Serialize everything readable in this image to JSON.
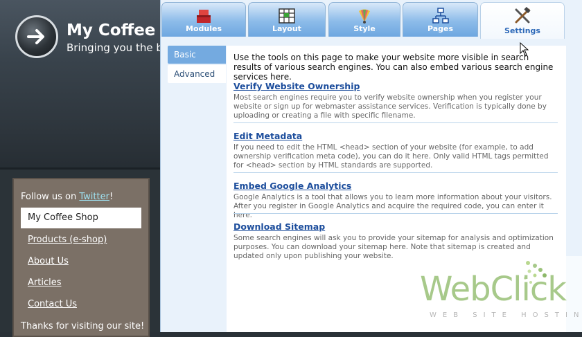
{
  "site": {
    "title": "My Coffee S",
    "tagline": "Bringing you the bes",
    "follow_prefix": "Follow us on ",
    "follow_link": "Twitter",
    "follow_suffix": "!",
    "nav": [
      {
        "label": "My Coffee Shop",
        "active": true
      },
      {
        "label": "Products (e-shop)",
        "active": false
      },
      {
        "label": "About Us",
        "active": false
      },
      {
        "label": "Articles",
        "active": false
      },
      {
        "label": "Contact Us",
        "active": false
      }
    ],
    "thanks": "Thanks for visiting our site!"
  },
  "tabs": [
    {
      "label": "Modules",
      "icon": "modules-icon",
      "active": false
    },
    {
      "label": "Layout",
      "icon": "layout-icon",
      "active": false
    },
    {
      "label": "Style",
      "icon": "style-icon",
      "active": false
    },
    {
      "label": "Pages",
      "icon": "pages-icon",
      "active": false
    },
    {
      "label": "Settings",
      "icon": "settings-icon",
      "active": true
    }
  ],
  "subnav": [
    {
      "label": "Basic",
      "active": true
    },
    {
      "label": "Advanced",
      "active": false
    }
  ],
  "content": {
    "intro": "Use the tools on this page to make your website more visible in search results of various search engines. You can also embed various search engine services here.",
    "sections": [
      {
        "title": "Verify Website Ownership",
        "desc": "Most search engines require you to verify website ownership when you register your website or sign up for webmaster assistance services. Verification is typically done by uploading or creating a file with specific filename."
      },
      {
        "title": "Edit Metadata",
        "desc": "If you need to edit the HTML <head> section of your website (for example, to add ownership verification meta code), you can do it here. Only valid HTML tags permitted for <head> section by HTML standards are supported."
      },
      {
        "title": "Embed Google Analytics",
        "desc": "Google Analytics is a tool that allows you to learn more information about your visitors. After you register in Google Analytics and acquire the required code, you can enter it here."
      },
      {
        "title": "Download Sitemap",
        "desc": "Some search engines will ask you to provide your sitemap for analysis and optimization purposes. You can download your sitemap here. Note that sitemap is created and updated only upon publishing your website."
      }
    ]
  },
  "watermark": {
    "brand": "WebClick",
    "sub": "WEB SITE HOSTING"
  },
  "colors": {
    "accent": "#74aae0",
    "link": "#1c4d9c",
    "tab_blue": "#6ea7e0",
    "sidebar": "#7b7066"
  }
}
